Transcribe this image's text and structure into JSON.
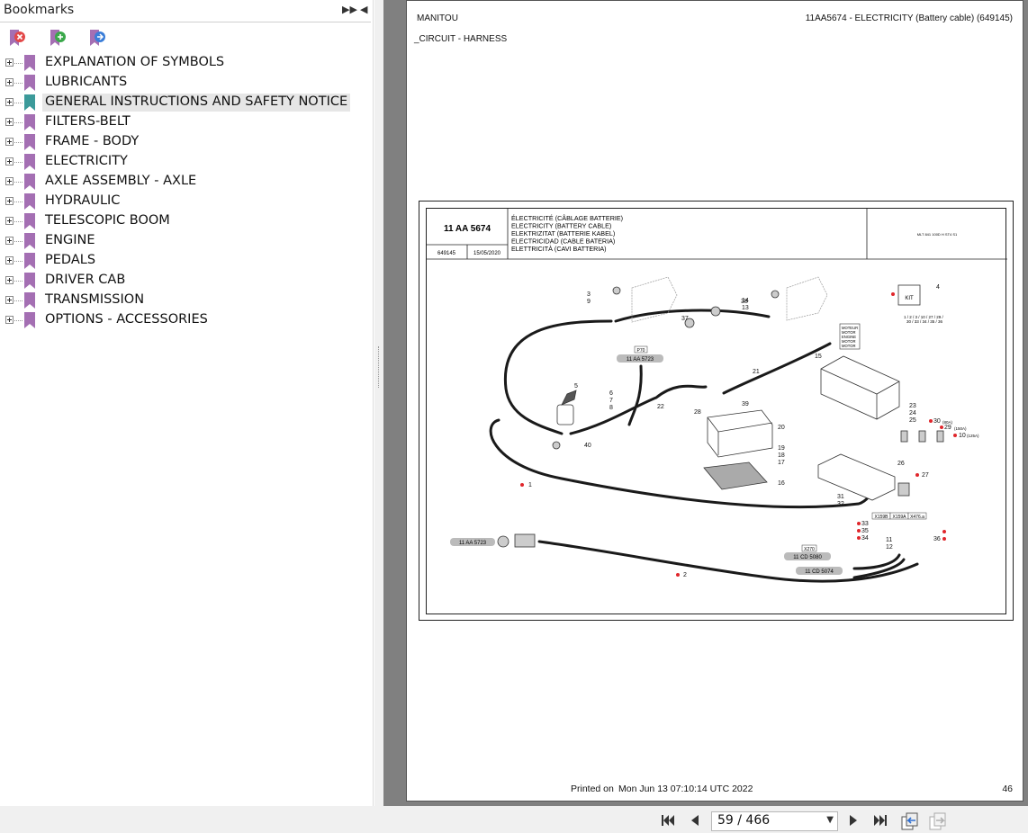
{
  "sidebar": {
    "title": "Bookmarks",
    "items": [
      {
        "label": "EXPLANATION OF SYMBOLS",
        "icon": "bookmark-purple",
        "selected": false
      },
      {
        "label": "LUBRICANTS",
        "icon": "bookmark-purple",
        "selected": false
      },
      {
        "label": "GENERAL INSTRUCTIONS AND SAFETY NOTICE",
        "icon": "bookmark-teal",
        "selected": true
      },
      {
        "label": "FILTERS-BELT",
        "icon": "bookmark-purple",
        "selected": false
      },
      {
        "label": "FRAME - BODY",
        "icon": "bookmark-purple",
        "selected": false
      },
      {
        "label": "ELECTRICITY",
        "icon": "bookmark-purple",
        "selected": false
      },
      {
        "label": "AXLE ASSEMBLY - AXLE",
        "icon": "bookmark-purple",
        "selected": false
      },
      {
        "label": "HYDRAULIC",
        "icon": "bookmark-purple",
        "selected": false
      },
      {
        "label": "TELESCOPIC BOOM",
        "icon": "bookmark-purple",
        "selected": false
      },
      {
        "label": "ENGINE",
        "icon": "bookmark-purple",
        "selected": false
      },
      {
        "label": "PEDALS",
        "icon": "bookmark-purple",
        "selected": false
      },
      {
        "label": "DRIVER CAB",
        "icon": "bookmark-purple",
        "selected": false
      },
      {
        "label": "TRANSMISSION",
        "icon": "bookmark-purple",
        "selected": false
      },
      {
        "label": "OPTIONS - ACCESSORIES",
        "icon": "bookmark-purple",
        "selected": false
      }
    ]
  },
  "page": {
    "brand": "MANITOU",
    "header_right": "11AA5674 - ELECTRICITY (Battery cable) (649145)",
    "subtitle": "_CIRCUIT - HARNESS",
    "footer_printed_label": "Printed on",
    "footer_date": "Mon Jun 13 07:10:14 UTC 2022",
    "page_number": "46",
    "drawing": {
      "ref": "11 AA 5674",
      "doc_no": "649145",
      "date": "15/05/2020",
      "titles": [
        "ÉLECTRICITÉ (CÂBLAGE BATTERIE)",
        "ELECTRICITY (BATTERY CABLE)",
        "ELEKTRIZITAT (BATTERIE KABEL)",
        "ELECTRICIDAD (CABLE BATERIA)",
        "ELETTRICITÀ (CAVI BATTERIA)"
      ],
      "model": "MLT 841 100D H ST4 S1",
      "kit_label": "KIT",
      "kit_items": "1 / 2 / 3 / 10 / 27 / 29 /",
      "kit_items2": "30 / 33 / 34 / 35 / 36",
      "motor_labels": [
        "MOTEUR",
        "MOTOR",
        "ENGINE",
        "MOTOR",
        "MOTOR"
      ],
      "callouts": [
        "1",
        "2",
        "3",
        "4",
        "5",
        "6",
        "7",
        "8",
        "9",
        "10",
        "11",
        "12",
        "13",
        "14",
        "15",
        "16",
        "17",
        "18",
        "19",
        "20",
        "21",
        "22",
        "23",
        "24",
        "25",
        "26",
        "27",
        "28",
        "29",
        "30",
        "31",
        "32",
        "33",
        "34",
        "35",
        "36",
        "37",
        "38",
        "39",
        "40"
      ],
      "refs": {
        "p70": "P70",
        "aa5723_top": "11 AA 5723",
        "aa5723_left": "11 AA 5723",
        "x270": "X270",
        "cd5080": "11 CD 5080",
        "cd5074": "11 CD 5074",
        "x159b": "X159B",
        "x159a": "X159A",
        "x476": "X476.a",
        "a80": "(80A)",
        "a150": "(150A)",
        "a125": "(125A)"
      }
    }
  },
  "toolbar": {
    "current_page": "59 / 466",
    "total_pages": 466,
    "current": 59
  },
  "colors": {
    "bookmark_purple": "#a46fb3",
    "bookmark_teal": "#3c9a9a",
    "viewer_bg": "#808080",
    "callout_dot": "#e0262c"
  }
}
